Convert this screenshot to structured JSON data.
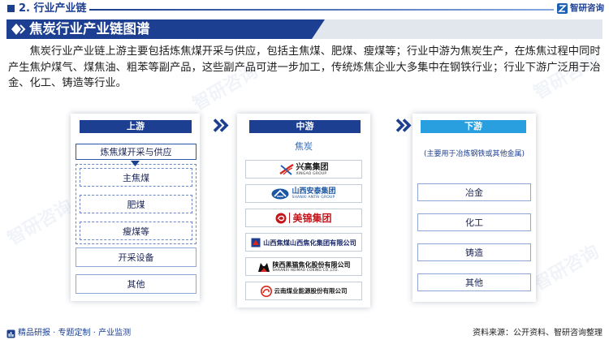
{
  "header": {
    "section_title": "2. 行业产业链",
    "brand_name": "智研咨询"
  },
  "banner": {
    "title": "焦炭行业产业链图谱"
  },
  "intro": {
    "paragraph": "焦炭行业产业链上游主要包括炼焦煤开采与供应，包括主焦煤、肥煤、瘦煤等；行业中游为焦炭生产，在炼焦过程中同时产生焦炉煤气、煤焦油、粗苯等副产品，这些副产品可进一步加工，传统炼焦企业大多集中在钢铁行业；行业下游广泛用于冶金、化工、铸造等行业。"
  },
  "upstream": {
    "label": "上游",
    "main_item": "炼焦煤开采与供应",
    "sub_items": [
      "主焦煤",
      "肥煤",
      "瘦煤等"
    ],
    "other_items": [
      "开采设备",
      "其他"
    ]
  },
  "midstream": {
    "label": "中游",
    "product": "焦炭",
    "companies": [
      {
        "name": "兴高集团",
        "name_en": "XINGAO GROUP"
      },
      {
        "name": "山西安泰集团",
        "name_en": "SHANXI ANTAI GROUP"
      },
      {
        "name": "美锦集团"
      },
      {
        "name": "山西焦煤山西焦化集团有限公司"
      },
      {
        "name": "陕西黑猫焦化股份有限公司",
        "name_en": "SHAANXI HEIMAO COKING CO.,LTD."
      },
      {
        "name": "云南煤业能源股份有限公司"
      }
    ]
  },
  "downstream": {
    "label": "下游",
    "note": "(主要用于冶炼钢铁或其他金属)",
    "items": [
      "冶金",
      "化工",
      "铸造",
      "其他"
    ]
  },
  "footer": {
    "tagline": "精品研报 · 专题定制 · 产业监测",
    "source": "资料来源：公开资料、智研咨询整理"
  },
  "watermark": {
    "text": "智研咨询"
  },
  "colors": {
    "primary_navy": "#1d3f91",
    "downstream_header": "#2a9fe0",
    "product_text": "#2f6cc4",
    "banner_strip": "#e2e6ed"
  },
  "icons": {
    "section_bullet": "square-bullet-icon",
    "banner": "diamond-icon",
    "flow_arrow": "double-chevron-right-icon",
    "down_arrow": "triangle-down-icon",
    "brand": "zhiyan-logo-icon",
    "footer": "report-icon"
  }
}
